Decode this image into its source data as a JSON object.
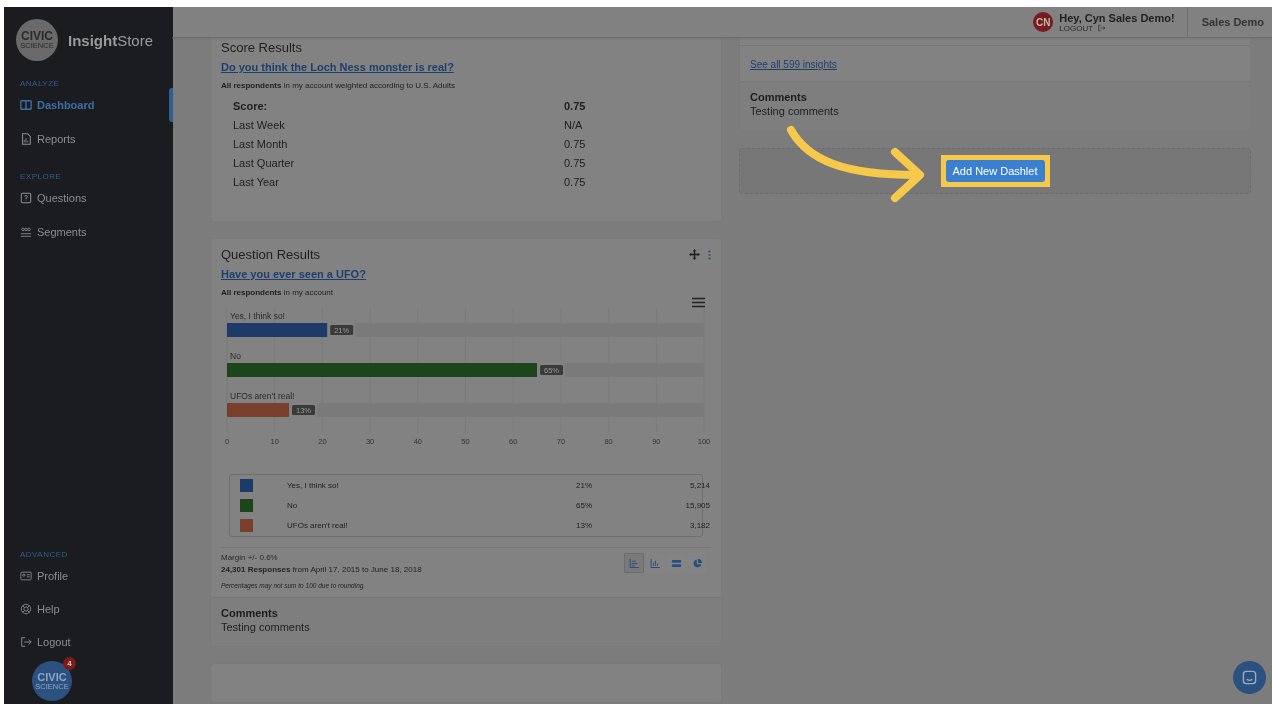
{
  "sidebar": {
    "logo": {
      "line_1": "CIVIC",
      "line_2": "SCIENCE"
    },
    "brand": "**Insight**Store",
    "sections": [
      {
        "heading": "ANALYZE",
        "items": [
          {
            "label": "Dashboard",
            "kind": "dashboard",
            "selected": true
          },
          {
            "label": "Reports",
            "kind": "report",
            "selected": false
          }
        ]
      },
      {
        "heading": "EXPLORE",
        "items": [
          {
            "label": "Questions",
            "kind": "question",
            "selected": false
          },
          {
            "label": "Segments",
            "kind": "segments",
            "selected": false
          }
        ]
      }
    ],
    "bottom_section": {
      "heading": "ADVANCED",
      "items": [
        {
          "label": "Profile",
          "kind": "profile",
          "selected": false
        },
        {
          "label": "Help",
          "kind": "help",
          "selected": false
        },
        {
          "label": "Logout",
          "kind": "logout",
          "selected": false
        }
      ]
    },
    "chat_launcher": {
      "line_1": "CIVIC",
      "line_2": "SCIENCE",
      "badge": "4"
    }
  },
  "header": {
    "avatar": "CN",
    "greeting": "Hey, Cyn Sales Demo!",
    "logout": "LOGOUT",
    "account": "Sales Demo"
  },
  "score_card": {
    "title": "Score Results",
    "question": "Do you think the Loch Ness monster is real?",
    "audience": "**All respondents** in my account weighted according to U.S. Adults",
    "score": {
      "label": "Score:",
      "value": "0.75"
    },
    "history": [
      {
        "label": "Last Week",
        "value": "N/A"
      },
      {
        "label": "Last Month",
        "value": "0.75"
      },
      {
        "label": "Last Quarter",
        "value": "0.75"
      },
      {
        "label": "Last Year",
        "value": "0.75"
      }
    ]
  },
  "question_card": {
    "title": "Question Results",
    "question": "Have you ever seen a UFO?",
    "audience": "**All respondents** in my account",
    "chart_data": {
      "type": "bar",
      "orientation": "horizontal",
      "series": [
        {
          "name": "Yes, I think so!",
          "color": "#1e3a68",
          "values": [
            21,
            null,
            null
          ]
        },
        {
          "name": "No",
          "color": "#1c451c",
          "values": [
            null,
            65,
            null
          ]
        },
        {
          "name": "UFOs aren't real!",
          "color": "#7a3f2c",
          "values": [
            null,
            null,
            13
          ]
        }
      ],
      "grid": true,
      "value_labels": [
        "21%",
        "65%",
        "13%"
      ],
      "xlim": [
        0,
        100
      ],
      "xticks": [
        0,
        10,
        20,
        30,
        40,
        50,
        60,
        70,
        80,
        90,
        100
      ]
    },
    "legend": [
      {
        "color": "#1e3a68",
        "label": "Yes, I think so!",
        "percent": "21%",
        "count": "5,214"
      },
      {
        "color": "#1c451c",
        "label": "No",
        "percent": "65%",
        "count": "15,905"
      },
      {
        "color": "#7a3f2c",
        "label": "UFOs aren't real!",
        "percent": "13%",
        "count": "3,182"
      }
    ],
    "margin": "Margin +/- 0.6%",
    "responses": "**24,301 Responses** from April 17, 2015 to June 18, 2018",
    "note": "Percentages may not sum to 100 due to rounding.",
    "view_buttons": [
      {
        "kind": "horizontal-bar",
        "selected": true
      },
      {
        "kind": "column",
        "selected": false
      },
      {
        "kind": "stacked",
        "selected": false
      },
      {
        "kind": "pie",
        "selected": false
      }
    ],
    "comments_heading": "Comments",
    "comments": "Testing comments"
  },
  "insights_card": {
    "link": "See all 599 insights",
    "comments_heading": "Comments",
    "comments": "Testing comments"
  },
  "add_dashlet": {
    "button": "Add New Dashlet"
  }
}
